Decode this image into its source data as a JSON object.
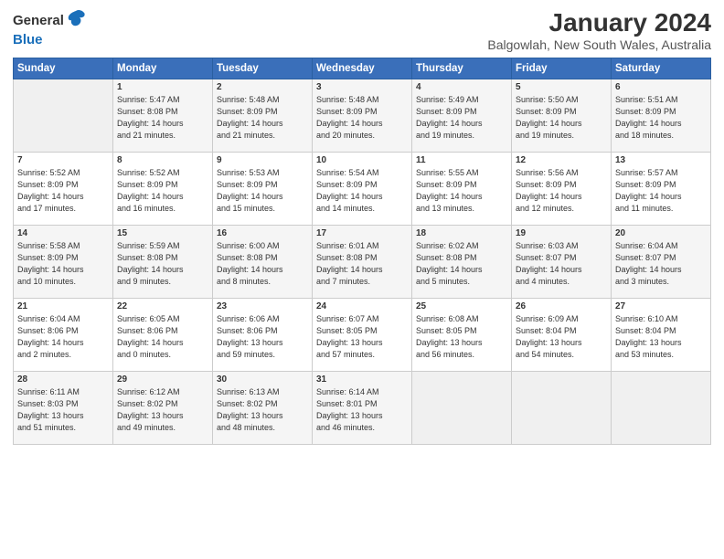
{
  "logo": {
    "general": "General",
    "blue": "Blue"
  },
  "title": "January 2024",
  "location": "Balgowlah, New South Wales, Australia",
  "days_of_week": [
    "Sunday",
    "Monday",
    "Tuesday",
    "Wednesday",
    "Thursday",
    "Friday",
    "Saturday"
  ],
  "weeks": [
    [
      {
        "day": "",
        "content": ""
      },
      {
        "day": "1",
        "content": "Sunrise: 5:47 AM\nSunset: 8:08 PM\nDaylight: 14 hours\nand 21 minutes."
      },
      {
        "day": "2",
        "content": "Sunrise: 5:48 AM\nSunset: 8:09 PM\nDaylight: 14 hours\nand 21 minutes."
      },
      {
        "day": "3",
        "content": "Sunrise: 5:48 AM\nSunset: 8:09 PM\nDaylight: 14 hours\nand 20 minutes."
      },
      {
        "day": "4",
        "content": "Sunrise: 5:49 AM\nSunset: 8:09 PM\nDaylight: 14 hours\nand 19 minutes."
      },
      {
        "day": "5",
        "content": "Sunrise: 5:50 AM\nSunset: 8:09 PM\nDaylight: 14 hours\nand 19 minutes."
      },
      {
        "day": "6",
        "content": "Sunrise: 5:51 AM\nSunset: 8:09 PM\nDaylight: 14 hours\nand 18 minutes."
      }
    ],
    [
      {
        "day": "7",
        "content": "Sunrise: 5:52 AM\nSunset: 8:09 PM\nDaylight: 14 hours\nand 17 minutes."
      },
      {
        "day": "8",
        "content": "Sunrise: 5:52 AM\nSunset: 8:09 PM\nDaylight: 14 hours\nand 16 minutes."
      },
      {
        "day": "9",
        "content": "Sunrise: 5:53 AM\nSunset: 8:09 PM\nDaylight: 14 hours\nand 15 minutes."
      },
      {
        "day": "10",
        "content": "Sunrise: 5:54 AM\nSunset: 8:09 PM\nDaylight: 14 hours\nand 14 minutes."
      },
      {
        "day": "11",
        "content": "Sunrise: 5:55 AM\nSunset: 8:09 PM\nDaylight: 14 hours\nand 13 minutes."
      },
      {
        "day": "12",
        "content": "Sunrise: 5:56 AM\nSunset: 8:09 PM\nDaylight: 14 hours\nand 12 minutes."
      },
      {
        "day": "13",
        "content": "Sunrise: 5:57 AM\nSunset: 8:09 PM\nDaylight: 14 hours\nand 11 minutes."
      }
    ],
    [
      {
        "day": "14",
        "content": "Sunrise: 5:58 AM\nSunset: 8:09 PM\nDaylight: 14 hours\nand 10 minutes."
      },
      {
        "day": "15",
        "content": "Sunrise: 5:59 AM\nSunset: 8:08 PM\nDaylight: 14 hours\nand 9 minutes."
      },
      {
        "day": "16",
        "content": "Sunrise: 6:00 AM\nSunset: 8:08 PM\nDaylight: 14 hours\nand 8 minutes."
      },
      {
        "day": "17",
        "content": "Sunrise: 6:01 AM\nSunset: 8:08 PM\nDaylight: 14 hours\nand 7 minutes."
      },
      {
        "day": "18",
        "content": "Sunrise: 6:02 AM\nSunset: 8:08 PM\nDaylight: 14 hours\nand 5 minutes."
      },
      {
        "day": "19",
        "content": "Sunrise: 6:03 AM\nSunset: 8:07 PM\nDaylight: 14 hours\nand 4 minutes."
      },
      {
        "day": "20",
        "content": "Sunrise: 6:04 AM\nSunset: 8:07 PM\nDaylight: 14 hours\nand 3 minutes."
      }
    ],
    [
      {
        "day": "21",
        "content": "Sunrise: 6:04 AM\nSunset: 8:06 PM\nDaylight: 14 hours\nand 2 minutes."
      },
      {
        "day": "22",
        "content": "Sunrise: 6:05 AM\nSunset: 8:06 PM\nDaylight: 14 hours\nand 0 minutes."
      },
      {
        "day": "23",
        "content": "Sunrise: 6:06 AM\nSunset: 8:06 PM\nDaylight: 13 hours\nand 59 minutes."
      },
      {
        "day": "24",
        "content": "Sunrise: 6:07 AM\nSunset: 8:05 PM\nDaylight: 13 hours\nand 57 minutes."
      },
      {
        "day": "25",
        "content": "Sunrise: 6:08 AM\nSunset: 8:05 PM\nDaylight: 13 hours\nand 56 minutes."
      },
      {
        "day": "26",
        "content": "Sunrise: 6:09 AM\nSunset: 8:04 PM\nDaylight: 13 hours\nand 54 minutes."
      },
      {
        "day": "27",
        "content": "Sunrise: 6:10 AM\nSunset: 8:04 PM\nDaylight: 13 hours\nand 53 minutes."
      }
    ],
    [
      {
        "day": "28",
        "content": "Sunrise: 6:11 AM\nSunset: 8:03 PM\nDaylight: 13 hours\nand 51 minutes."
      },
      {
        "day": "29",
        "content": "Sunrise: 6:12 AM\nSunset: 8:02 PM\nDaylight: 13 hours\nand 49 minutes."
      },
      {
        "day": "30",
        "content": "Sunrise: 6:13 AM\nSunset: 8:02 PM\nDaylight: 13 hours\nand 48 minutes."
      },
      {
        "day": "31",
        "content": "Sunrise: 6:14 AM\nSunset: 8:01 PM\nDaylight: 13 hours\nand 46 minutes."
      },
      {
        "day": "",
        "content": ""
      },
      {
        "day": "",
        "content": ""
      },
      {
        "day": "",
        "content": ""
      }
    ]
  ]
}
